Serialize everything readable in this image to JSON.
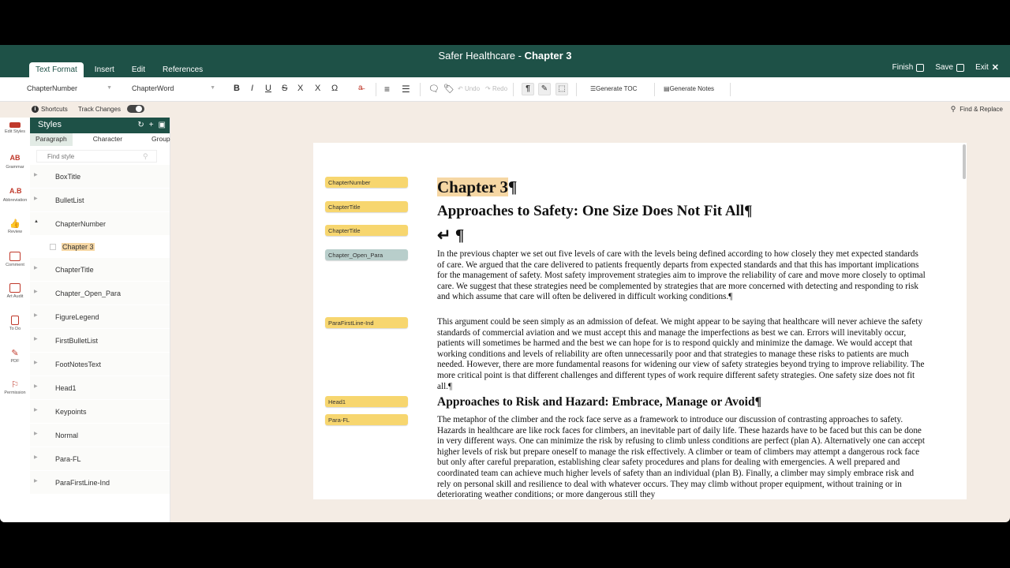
{
  "titlebar": {
    "app_name": "Safer Healthcare",
    "separator": " - ",
    "chapter": "Chapter 3",
    "tabs": [
      {
        "label": "Text Format",
        "active": true
      },
      {
        "label": "Insert",
        "active": false
      },
      {
        "label": "Edit",
        "active": false
      },
      {
        "label": "References",
        "active": false
      }
    ],
    "finish_label": "Finish",
    "save_label": "Save",
    "exit_label": "Exit"
  },
  "toolbar": {
    "paragraph_style": "ChapterNumber",
    "character_style": "ChapterWord",
    "bold": "B",
    "italic": "I",
    "underline": "U",
    "strike": "S",
    "subscript": "X",
    "superscript": "X",
    "omega": "Ω",
    "undo": "Undo",
    "redo": "Redo",
    "pilcrow": "¶",
    "generate_toc": "Generate TOC",
    "generate_notes": "Generate Notes"
  },
  "subbar": {
    "shortcuts": "Shortcuts",
    "track_changes": "Track Changes",
    "find_replace": "Find & Replace"
  },
  "rail": [
    {
      "label": "Edit Styles",
      "icon": "edit-styles-icon"
    },
    {
      "label": "Grammar",
      "icon": "grammar-icon"
    },
    {
      "label": "Abbreviation",
      "icon": "abbreviation-icon"
    },
    {
      "label": "Review",
      "icon": "thumbs-up-icon"
    },
    {
      "label": "Comment",
      "icon": "comment-icon"
    },
    {
      "label": "Art Audit",
      "icon": "art-audit-icon"
    },
    {
      "label": "To Do",
      "icon": "todo-icon"
    },
    {
      "label": "PDF",
      "icon": "pdf-icon"
    },
    {
      "label": "Permission",
      "icon": "permission-icon"
    }
  ],
  "styles_panel": {
    "title": "Styles",
    "tabs": [
      "Paragraph",
      "Character",
      "Group"
    ],
    "find_placeholder": "Find style",
    "items": [
      "BoxTitle",
      "BulletList",
      "ChapterNumber",
      "ChapterTitle",
      "Chapter_Open_Para",
      "FigureLegend",
      "FirstBulletList",
      "FootNotesText",
      "Head1",
      "Keypoints",
      "Normal",
      "Para-FL",
      "ParaFirstLine-Ind"
    ],
    "expanded_child": "Chapter 3"
  },
  "tags": [
    "ChapterNumber",
    "ChapterTitle",
    "ChapterTitle",
    "Chapter_Open_Para",
    "ParaFirstLine-Ind",
    "Head1",
    "Para-FL"
  ],
  "document": {
    "chapter_number": "Chapter 3",
    "pilcrow": "¶",
    "chapter_title": "Approaches to Safety: One Size Does Not Fit All¶",
    "return_mark": "↵ ¶",
    "para1": "In the previous chapter we set out five levels of care with the levels being defined according to how closely they met expected standards of care. We argued that the care delivered to patients frequently departs from expected standards and that this has important implications for the management of safety. Most safety improvement strategies aim to improve the reliability of care and move more closely to optimal care. We suggest that these strategies need be complemented by strategies that are more concerned with detecting and responding to risk and which assume that care will often be delivered in difficult working conditions.¶",
    "para2": "This argument could be seen simply as an admission of defeat. We might appear to be saying that healthcare will never achieve the safety standards of commercial aviation and we must accept this and manage the imperfections as best we can. Errors will inevitably occur, patients will sometimes be harmed and the best we can hope for is to respond quickly and minimize the damage. We would accept that working conditions and levels of reliability are often unnecessarily poor and that strategies to manage these risks to patients are much needed. However, there are more fundamental reasons for widening our view of safety strategies beyond trying to improve reliability. The more critical point is that different challenges and different types of work require different safety strategies. One safety size does not fit all.¶",
    "head1": "Approaches to Risk and Hazard: Embrace, Manage or Avoid¶",
    "para3": "The metaphor of the climber and the rock face serve as a framework to introduce our discussion of contrasting approaches to safety. Hazards in healthcare are like rock faces for climbers, an inevitable part of daily life. These hazards have to be faced but this can be done in very different ways. One can minimize the risk by refusing to climb unless conditions are perfect (plan A). Alternatively one can accept higher levels of risk but prepare oneself to manage the risk effectively. A climber or team of climbers may attempt a dangerous rock face but only after careful preparation, establishing clear safety procedures and plans for dealing with emergencies. A well prepared and coordinated team can achieve much higher levels of safety than an individual (plan B). Finally, a climber may simply embrace risk and rely on personal skill and resilience to deal with whatever occurs. They may climb without proper equipment, without training or in deteriorating weather conditions; or more dangerous still they"
  }
}
